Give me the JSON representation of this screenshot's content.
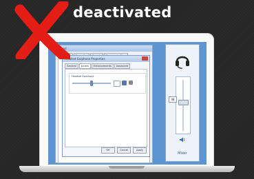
{
  "banner": {
    "title": "deactivated"
  },
  "icons": {
    "status": "red-x-icon",
    "device": "headset-icon",
    "volume": "speaker-icon"
  },
  "colors": {
    "x_mark": "#e41e16",
    "desktop": "#5d95d4",
    "background": "#262626"
  },
  "sound_window": {
    "title": "Sound",
    "tabs": [
      "Playback",
      "Recording",
      "Sounds",
      "Communications"
    ]
  },
  "properties_window": {
    "title": "Headset Earphone Properties",
    "tabs": [
      "General",
      "Levels",
      "Enhancements",
      "Advanced"
    ],
    "group_label": "Headset Earphone",
    "buttons": {
      "ok": "OK",
      "cancel": "Cancel",
      "apply": "Apply"
    }
  },
  "mixer": {
    "level": "48",
    "label": "Mixer"
  }
}
